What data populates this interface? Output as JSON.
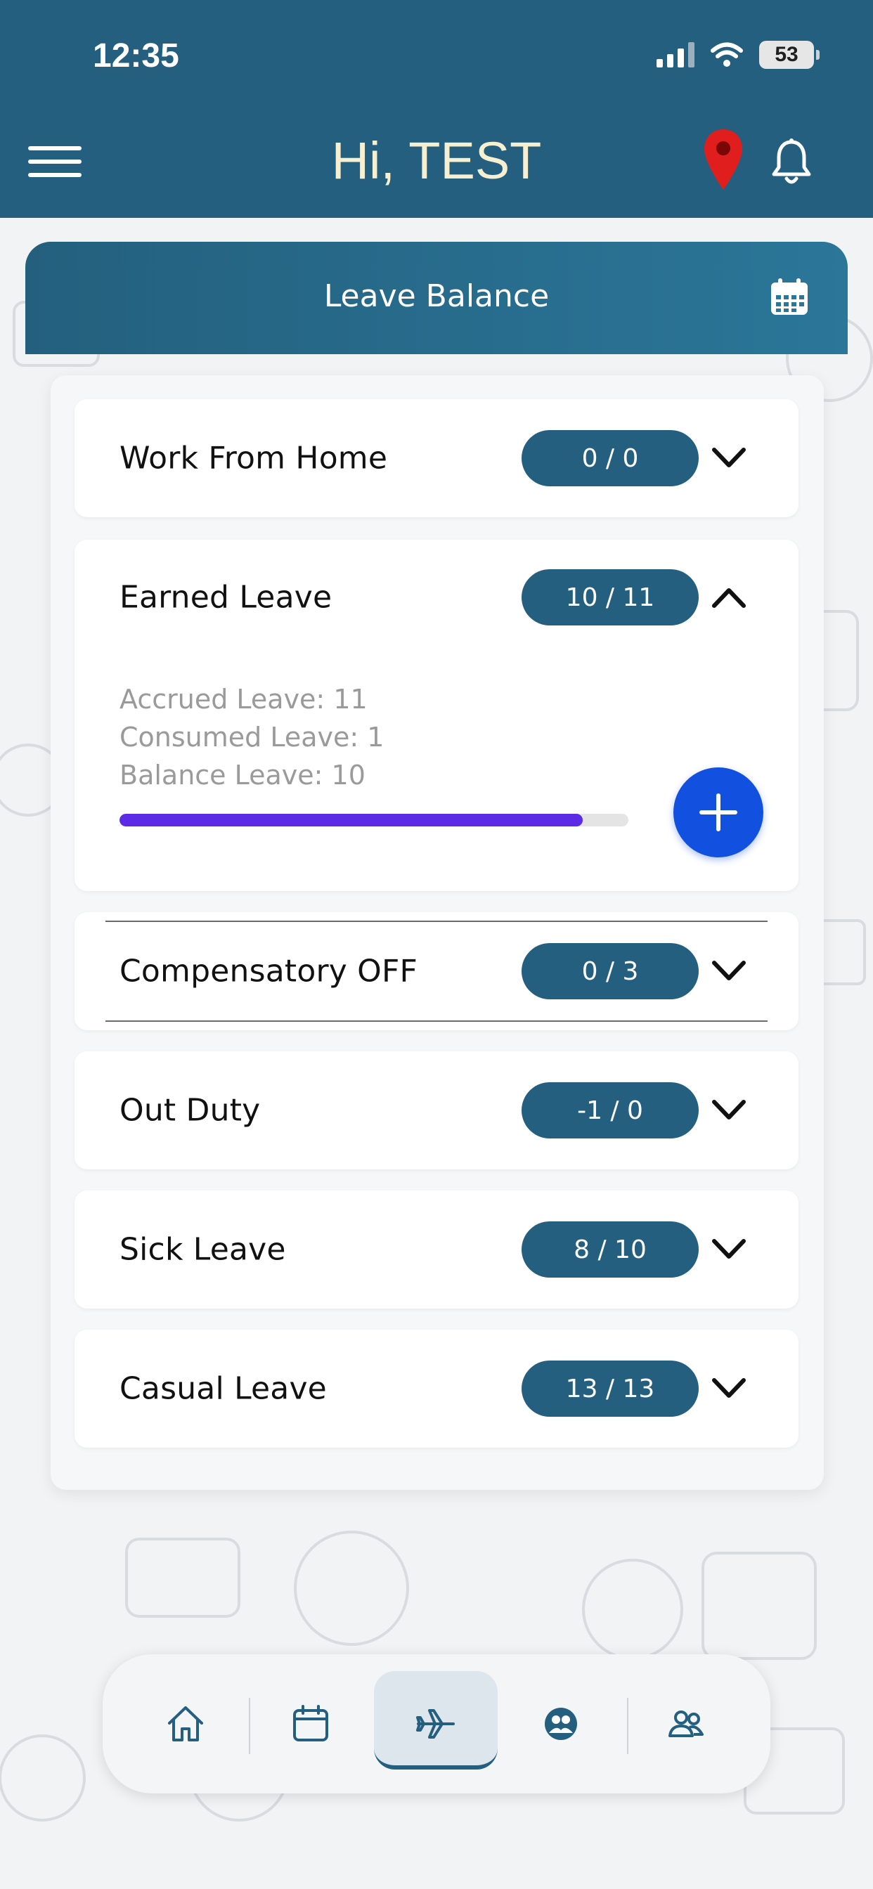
{
  "status_bar": {
    "time": "12:35",
    "battery": "53"
  },
  "header": {
    "greeting": "Hi, TEST"
  },
  "leave_balance": {
    "title": "Leave Balance",
    "items": [
      {
        "label": "Work From Home",
        "count": "0 / 0",
        "expanded": false
      },
      {
        "label": "Earned Leave",
        "count": "10 / 11",
        "expanded": true,
        "accrued": "Accrued Leave: 11",
        "consumed": "Consumed Leave: 1",
        "balance": "Balance Leave: 10",
        "progress_fraction": 0.91
      },
      {
        "label": "Compensatory OFF",
        "count": "0 / 3",
        "expanded": false
      },
      {
        "label": "Out Duty",
        "count": "-1 / 0",
        "expanded": false
      },
      {
        "label": "Sick Leave",
        "count": "8 / 10",
        "expanded": false
      },
      {
        "label": "Casual Leave",
        "count": "13 / 13",
        "expanded": false
      }
    ]
  },
  "bottom_nav": {
    "items": [
      {
        "icon": "home-icon"
      },
      {
        "icon": "calendar-icon"
      },
      {
        "icon": "airplane-icon",
        "active": true
      },
      {
        "icon": "team-circle-icon"
      },
      {
        "icon": "people-icon"
      }
    ]
  },
  "colors": {
    "primary": "#255f7f",
    "accent_progress": "#5b2be6",
    "fab": "#1250e0",
    "greeting": "#f6f0d0",
    "pin": "#e01e1e"
  }
}
